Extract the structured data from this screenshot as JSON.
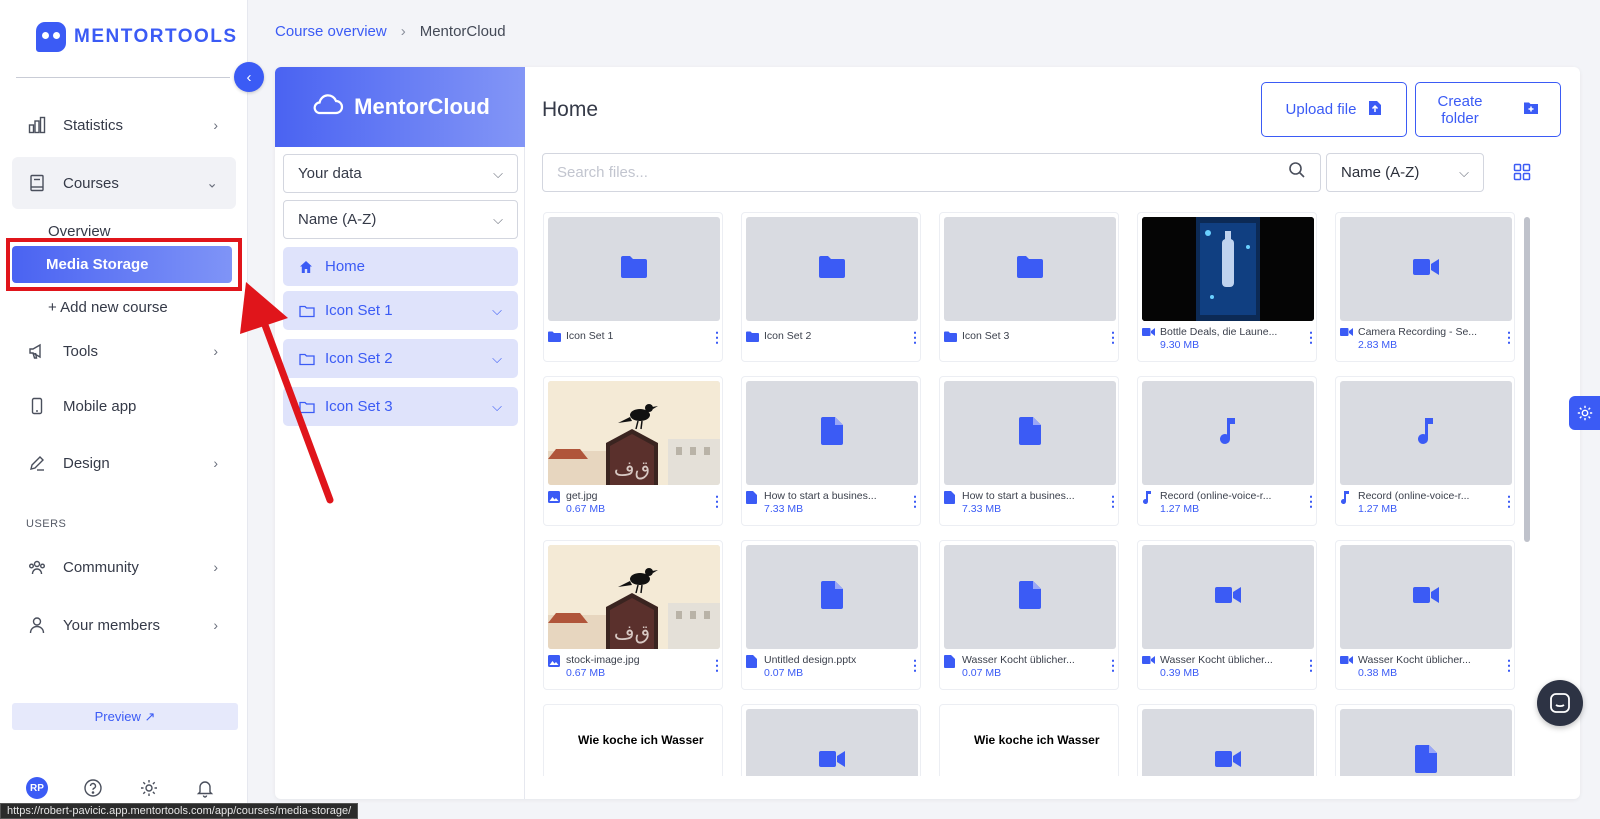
{
  "brand": {
    "name": "MENTORTOOLS",
    "accent": "#3b5bf5"
  },
  "sidebar": {
    "items": [
      {
        "label": "Statistics",
        "icon": "bar-chart-icon"
      },
      {
        "label": "Courses",
        "icon": "book-icon"
      },
      {
        "label": "Tools",
        "icon": "megaphone-icon"
      },
      {
        "label": "Mobile app",
        "icon": "mobile-icon"
      },
      {
        "label": "Design",
        "icon": "pencil-icon"
      },
      {
        "label": "Community",
        "icon": "community-icon"
      },
      {
        "label": "Your members",
        "icon": "user-icon"
      }
    ],
    "courses_sub": {
      "overview": "Overview",
      "media_storage": "Media Storage",
      "add_course": "+ Add new course"
    },
    "users_label": "USERS",
    "preview_label": "Preview ↗",
    "avatar_initials": "RP"
  },
  "status_url": "https://robert-pavicic.app.mentortools.com/app/courses/media-storage/",
  "breadcrumb": {
    "parent": "Course overview",
    "current": "MentorCloud"
  },
  "cloud": {
    "title": "MentorCloud",
    "data_select": "Your data",
    "sort_select": "Name (A-Z)",
    "home_label": "Home",
    "folders": [
      "Icon Set 1",
      "Icon Set 2",
      "Icon Set 3"
    ]
  },
  "main": {
    "title": "Home",
    "upload_label": "Upload file",
    "create_label_1": "Create",
    "create_label_2": "folder",
    "search_placeholder": "Search files...",
    "sort_value": "Name (A-Z)"
  },
  "files": [
    {
      "name": "Icon Set 1",
      "size": "",
      "type": "folder",
      "thumb": "folder"
    },
    {
      "name": "Icon Set 2",
      "size": "",
      "type": "folder",
      "thumb": "folder"
    },
    {
      "name": "Icon Set 3",
      "size": "",
      "type": "folder",
      "thumb": "folder"
    },
    {
      "name": "Bottle Deals, die Laune...",
      "size": "9.30 MB",
      "type": "video",
      "thumb": "video-still"
    },
    {
      "name": "Camera Recording - Se...",
      "size": "2.83 MB",
      "type": "video",
      "thumb": "video"
    },
    {
      "name": "get.jpg",
      "size": "0.67 MB",
      "type": "image",
      "thumb": "photo"
    },
    {
      "name": "How to start a busines...",
      "size": "7.33 MB",
      "type": "file",
      "thumb": "file"
    },
    {
      "name": "How to start a busines...",
      "size": "7.33 MB",
      "type": "file",
      "thumb": "file"
    },
    {
      "name": "Record (online-voice-r...",
      "size": "1.27 MB",
      "type": "audio",
      "thumb": "audio"
    },
    {
      "name": "Record (online-voice-r...",
      "size": "1.27 MB",
      "type": "audio",
      "thumb": "audio"
    },
    {
      "name": "stock-image.jpg",
      "size": "0.67 MB",
      "type": "image",
      "thumb": "photo"
    },
    {
      "name": "Untitled design.pptx",
      "size": "0.07 MB",
      "type": "file",
      "thumb": "file"
    },
    {
      "name": "Wasser Kocht üblicher...",
      "size": "0.07 MB",
      "type": "file",
      "thumb": "file"
    },
    {
      "name": "Wasser Kocht üblicher...",
      "size": "0.39 MB",
      "type": "video",
      "thumb": "video"
    },
    {
      "name": "Wasser Kocht üblicher...",
      "size": "0.38 MB",
      "type": "video",
      "thumb": "video"
    },
    {
      "name": "",
      "size": "",
      "type": "image",
      "thumb": "text",
      "thumb_text": "Wie koche ich Wasser"
    },
    {
      "name": "",
      "size": "",
      "type": "video",
      "thumb": "video"
    },
    {
      "name": "",
      "size": "",
      "type": "image",
      "thumb": "text",
      "thumb_text": "Wie koche ich Wasser"
    },
    {
      "name": "",
      "size": "",
      "type": "video",
      "thumb": "video"
    },
    {
      "name": "",
      "size": "",
      "type": "file",
      "thumb": "file"
    }
  ]
}
